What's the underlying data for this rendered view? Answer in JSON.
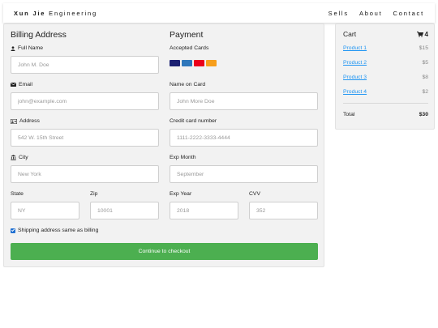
{
  "nav": {
    "brand_bold": "Xun Jie",
    "brand_rest": "Engineering",
    "links": [
      "Sells",
      "About",
      "Contact"
    ]
  },
  "billing": {
    "heading": "Billing Address",
    "full_name": {
      "label": "Full Name",
      "placeholder": "John M. Doe",
      "icon": "user-icon"
    },
    "email": {
      "label": "Email",
      "placeholder": "john@example.com",
      "icon": "envelope-icon"
    },
    "address": {
      "label": "Address",
      "placeholder": "542 W. 15th Street",
      "icon": "address-card-icon"
    },
    "city": {
      "label": "City",
      "placeholder": "New York",
      "icon": "institution-icon"
    },
    "state": {
      "label": "State",
      "placeholder": "NY"
    },
    "zip": {
      "label": "Zip",
      "placeholder": "10001"
    }
  },
  "payment": {
    "heading": "Payment",
    "accepted_cards_label": "Accepted Cards",
    "cards": [
      {
        "name": "visa-icon",
        "color": "#1a1f71"
      },
      {
        "name": "amex-icon",
        "color": "#2e77bb"
      },
      {
        "name": "mastercard-icon",
        "color": "#eb001b"
      },
      {
        "name": "discover-icon",
        "color": "#f79e1b"
      }
    ],
    "name_on_card": {
      "label": "Name on Card",
      "placeholder": "John More Doe"
    },
    "card_number": {
      "label": "Credit card number",
      "placeholder": "1111-2222-3333-4444"
    },
    "exp_month": {
      "label": "Exp Month",
      "placeholder": "September"
    },
    "exp_year": {
      "label": "Exp Year",
      "placeholder": "2018"
    },
    "cvv": {
      "label": "CVV",
      "placeholder": "352"
    }
  },
  "shipping_checkbox": {
    "label": "Shipping address same as billing",
    "checked": true
  },
  "checkout_button": {
    "label": "Continue to checkout",
    "color": "#4caf50"
  },
  "cart": {
    "title": "Cart",
    "count": "4",
    "items": [
      {
        "name": "Product 1",
        "price": "$15"
      },
      {
        "name": "Product 2",
        "price": "$5"
      },
      {
        "name": "Product 3",
        "price": "$8"
      },
      {
        "name": "Product 4",
        "price": "$2"
      }
    ],
    "total_label": "Total",
    "total_value": "$30",
    "link_color": "#2196f3"
  }
}
